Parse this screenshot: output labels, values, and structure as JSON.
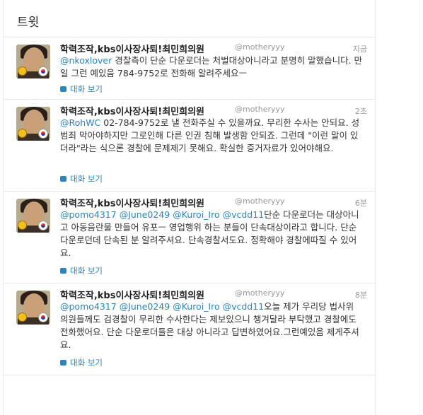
{
  "page": {
    "title": "트윗"
  },
  "tweets": [
    {
      "name": "학력조작,kbs이사장사퇴!최민희의원",
      "handle": "@motheryyy",
      "time": "지금",
      "mentions": "@nkoxlover",
      "body": " 경찰측이 단순 다운로더는 처벌대상아니라고 분명히 말했습니다. 만일 그런 예있음 784-9752로 전화해 알려주세요ㅡ",
      "convo": "대화 보기"
    },
    {
      "name": "학력조작,kbs이사장사퇴!최민희의원",
      "handle": "@motheryyy",
      "time": "2초",
      "mentions": "@RohWC",
      "body": " 02-784-9752로 낼 전화주실 수 있을까요. 무리한 수사는 안되요. 성범죄 막아야하지만 그로인해 다른 인권 침해 발생함 안되죠. 그런데 \"이런 말이 있더라\"라는 식으론 경찰에 문제제기 못해요. 확실한 증거자료가 있어야해요.",
      "convo": "대화 보기"
    },
    {
      "name": "학력조작,kbs이사장사퇴!최민희의원",
      "handle": "@motheryyy",
      "time": "6분",
      "mentions": "@pomo4317 @June0249 @Kuroi_Iro @vcdd11",
      "body": "단순 다운로더는 대상아니고 아동음란물 만들어 유포ㅡ 영업행위 하는 분들이 단속대상이라고 합니다. 단순다운로던데 단속된 분 알려주셔요. 단속경찰서도요. 정확해야 경찰에따질 수 있어요.",
      "convo": "대화 보기"
    },
    {
      "name": "학력조작,kbs이사장사퇴!최민희의원",
      "handle": "@motheryyy",
      "time": "8분",
      "mentions": "@pomo4317 @June0249 @Kuroi_Iro @vcdd11",
      "body": "오늘 제가 우리당 법사위 의원들께도 검경찰이 무리한 수사한다는 제보있으니 챙겨달라 부탁했고 경찰에도 전화했어요. 단순 다운로더들은 대상 아니라고 답변하였어요.그런예있음 제게주셔요.",
      "convo": "대화 보기"
    }
  ],
  "colors": {
    "link": "#2a85c3",
    "text": "#333333",
    "muted": "#999999",
    "divider": "#e8e8e8"
  }
}
